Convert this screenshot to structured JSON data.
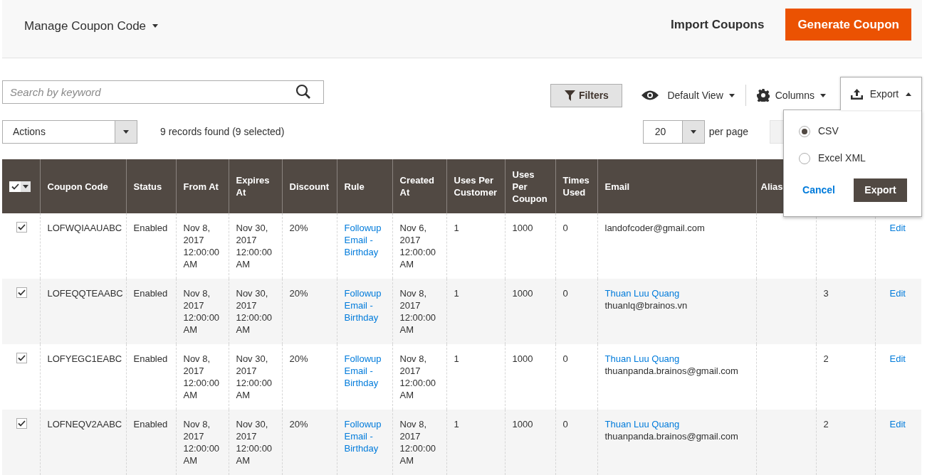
{
  "page_header": {
    "title": "Manage Coupon Code",
    "import_label": "Import Coupons",
    "generate_label": "Generate Coupon"
  },
  "toolbar": {
    "search": {
      "placeholder": "Search by keyword"
    },
    "filters": "Filters",
    "view": "Default View",
    "columns": "Columns",
    "export": {
      "label": "Export",
      "expanded": true,
      "options": [
        {
          "label": "CSV",
          "selected": true
        },
        {
          "label": "Excel XML",
          "selected": false
        }
      ],
      "cancel": "Cancel",
      "submit": "Export"
    }
  },
  "actions": {
    "label": "Actions",
    "records": "9 records found (9 selected)",
    "per_page": {
      "value": "20",
      "label": "per page"
    }
  },
  "table": {
    "all_checked": true,
    "columns": [
      "Coupon Code",
      "Status",
      "From At",
      "Expires At",
      "Discount",
      "Rule",
      "Created At",
      "Uses Per Customer",
      "Uses Per Coupon",
      "Times Used",
      "Email",
      "Alias"
    ],
    "rows": [
      {
        "checked": true,
        "code": "LOFWQIAAUABC",
        "status": "Enabled",
        "from_at": "Nov 8, 2017 12:00:00 AM",
        "expires_at": "Nov 30, 2017 12:00:00 AM",
        "discount": "20%",
        "rule": "Followup Email - Birthday",
        "created_at": "Nov 6, 2017 12:00:00 AM",
        "uses_per_customer": "1",
        "uses_per_coupon": "1000",
        "times_used": "0",
        "email": {
          "address": "landofcoder@gmail.com"
        },
        "action": "Edit"
      },
      {
        "checked": true,
        "code": "LOFEQQTEAABC",
        "status": "Enabled",
        "from_at": "Nov 8, 2017 12:00:00 AM",
        "expires_at": "Nov 30, 2017 12:00:00 AM",
        "discount": "20%",
        "rule": "Followup Email - Birthday",
        "created_at": "Nov 8, 2017 12:00:00 AM",
        "uses_per_customer": "1",
        "uses_per_coupon": "1000",
        "times_used": "0",
        "email": {
          "name": "Thuan Luu Quang",
          "address": "thuanlq@brainos.vn"
        },
        "column_14": "3",
        "action": "Edit"
      },
      {
        "checked": true,
        "code": "LOFYEGC1EABC",
        "status": "Enabled",
        "from_at": "Nov 8, 2017 12:00:00 AM",
        "expires_at": "Nov 30, 2017 12:00:00 AM",
        "discount": "20%",
        "rule": "Followup Email - Birthday",
        "created_at": "Nov 8, 2017 12:00:00 AM",
        "uses_per_customer": "1",
        "uses_per_coupon": "1000",
        "times_used": "0",
        "email": {
          "name": "Thuan Luu Quang",
          "address": "thuanpanda.brainos@gmail.com"
        },
        "column_14": "2",
        "action": "Edit"
      },
      {
        "checked": true,
        "code": "LOFNEQV2AABC",
        "status": "Enabled",
        "from_at": "Nov 8, 2017 12:00:00 AM",
        "expires_at": "Nov 30, 2017 12:00:00 AM",
        "discount": "20%",
        "rule": "Followup Email - Birthday",
        "created_at": "Nov 8, 2017 12:00:00 AM",
        "uses_per_customer": "1",
        "uses_per_coupon": "1000",
        "times_used": "0",
        "email": {
          "name": "Thuan Luu Quang",
          "address": "thuanpanda.brainos@gmail.com"
        },
        "column_14": "2",
        "action": "Edit"
      }
    ]
  }
}
